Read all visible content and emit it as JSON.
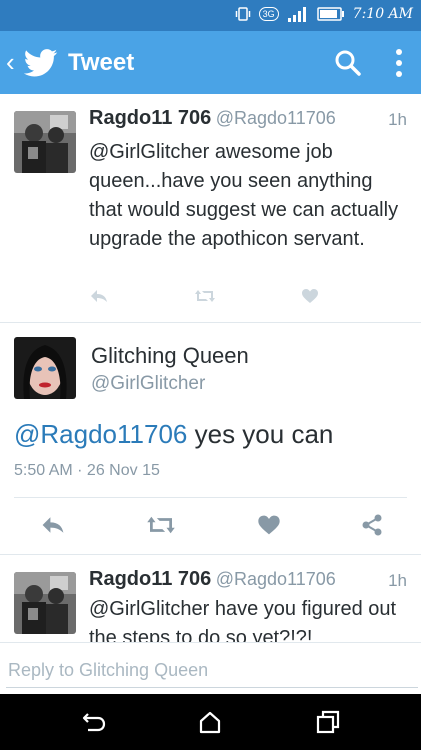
{
  "status_bar": {
    "network": "3G",
    "time": "7:10 AM",
    "icons": [
      "vibrate-icon",
      "signal-icon",
      "battery-icon"
    ]
  },
  "app_bar": {
    "title": "Tweet",
    "icons": [
      "back-chevron-icon",
      "twitter-bird-icon",
      "search-icon",
      "more-vert-icon"
    ]
  },
  "tweets": [
    {
      "name": "Ragdo11 706",
      "handle": "@Ragdo11706",
      "time": "1h",
      "text": "@GirlGlitcher awesome job queen...have you seen anything that would suggest we can actually upgrade the apothicon servant."
    },
    {
      "name": "Ragdo11 706",
      "handle": "@Ragdo11706",
      "time": "1h",
      "text": "@GirlGlitcher have you figured out the steps to do so yet?!?!"
    }
  ],
  "focused_tweet": {
    "name": "Glitching Queen",
    "handle": "@GirlGlitcher",
    "mention": "@Ragdo11706",
    "text": " yes you can",
    "date": "5:50 AM · 26 Nov 15"
  },
  "reply": {
    "placeholder": "Reply to Glitching Queen"
  },
  "colors": {
    "status_bar": "#2f7cbf",
    "app_bar": "#4aa3e6",
    "link": "#2b7bb9",
    "secondary_text": "#8899a6"
  }
}
